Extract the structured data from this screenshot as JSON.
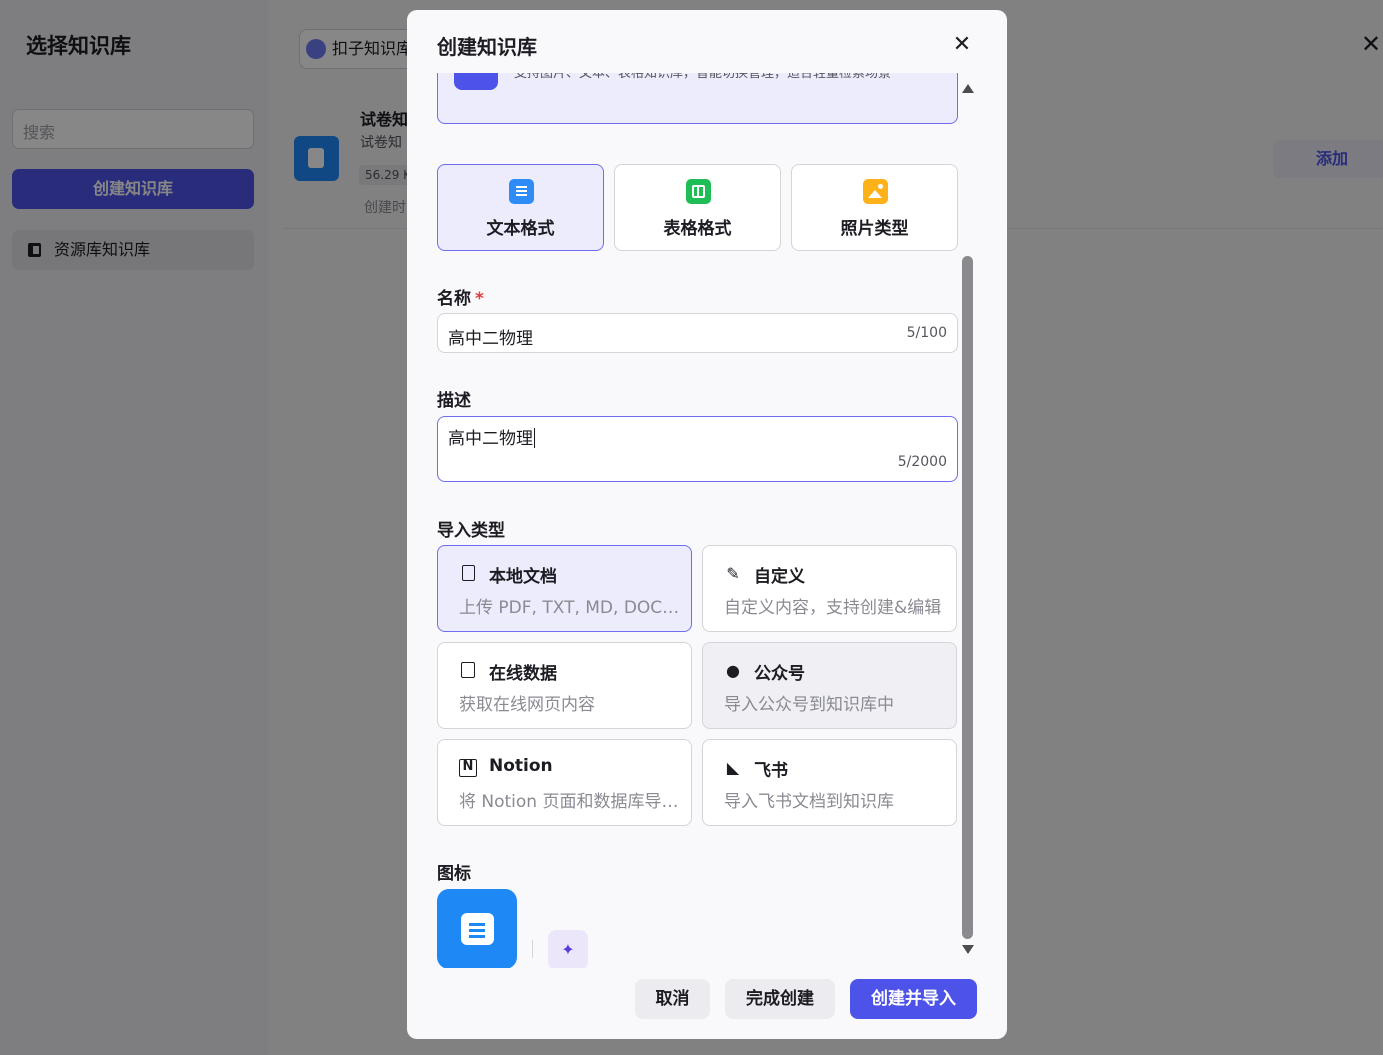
{
  "background": {
    "sidebar_title": "选择知识库",
    "search_placeholder": "搜索",
    "create_button": "创建知识库",
    "library_item": "资源库知识库",
    "tab_label": "扣子知识库",
    "card": {
      "title": "试卷知",
      "subtitle": "试卷知",
      "size": "56.29 K",
      "date_prefix": "创建时"
    },
    "add_button": "添加"
  },
  "modal": {
    "title": "创建知识库",
    "top_card_text": "支持图片、文本、表格知识库，智能切换管理，适合轻量检索场景",
    "formats": [
      {
        "label": "文本格式",
        "icon": "text-doc-icon",
        "active": true
      },
      {
        "label": "表格格式",
        "icon": "table-icon",
        "active": false
      },
      {
        "label": "照片类型",
        "icon": "photo-icon",
        "active": false
      }
    ],
    "name": {
      "label": "名称",
      "required_mark": "*",
      "value": "高中二物理",
      "count": "5/100"
    },
    "description": {
      "label": "描述",
      "value": "高中二物理",
      "count": "5/2000"
    },
    "import_label": "导入类型",
    "import_types": [
      {
        "title": "本地文档",
        "desc": "上传 PDF, TXT, MD, DOC, DOCX 格式的本地文件",
        "icon": "local-doc-icon"
      },
      {
        "title": "自定义",
        "desc": "自定义内容，支持创建&编辑",
        "icon": "custom-edit-icon"
      },
      {
        "title": "在线数据",
        "desc": "获取在线网页内容",
        "icon": "online-data-icon"
      },
      {
        "title": "公众号",
        "desc": "导入公众号到知识库中",
        "icon": "wechat-icon"
      },
      {
        "title": "Notion",
        "desc": "将 Notion 页面和数据库导入到知识库中",
        "icon": "notion-icon"
      },
      {
        "title": "飞书",
        "desc": "导入飞书文档到知识库",
        "icon": "feishu-icon"
      }
    ],
    "icon_label": "图标",
    "buttons": {
      "cancel": "取消",
      "done": "完成创建",
      "create_import": "创建并导入"
    }
  },
  "colors": {
    "accent": "#4d53e8",
    "accent_light": "#ececfd",
    "border": "#d4d4d9"
  }
}
